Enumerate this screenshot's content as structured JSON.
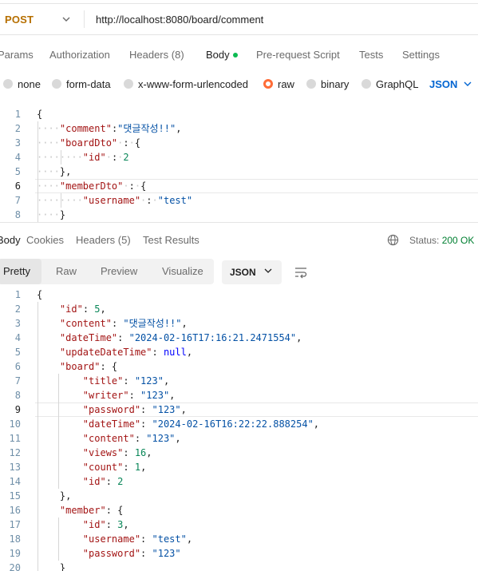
{
  "request": {
    "method": "POST",
    "url": "http://localhost:8080/board/comment"
  },
  "request_tabs": {
    "params": "Params",
    "authorization": "Authorization",
    "headers": "Headers",
    "headers_count": "(8)",
    "body": "Body",
    "pre_request_script": "Pre-request Script",
    "tests": "Tests",
    "settings": "Settings"
  },
  "body_types": {
    "none": "none",
    "form_data": "form-data",
    "urlencoded": "x-www-form-urlencoded",
    "raw": "raw",
    "binary": "binary",
    "graphql": "GraphQL",
    "selected": "raw",
    "language": "JSON"
  },
  "request_body_lines": [
    {
      "n": "1",
      "text": "{"
    },
    {
      "n": "2",
      "text": "    \"comment\":\"댓글작성!!\","
    },
    {
      "n": "3",
      "text": "    \"boardDto\" : {"
    },
    {
      "n": "4",
      "text": "        \"id\" : 2"
    },
    {
      "n": "5",
      "text": "    },"
    },
    {
      "n": "6",
      "text": "    \"memberDto\" : {"
    },
    {
      "n": "7",
      "text": "        \"username\" : \"test\""
    },
    {
      "n": "8",
      "text": "    }"
    }
  ],
  "response_tabs": {
    "body": "Body",
    "cookies": "Cookies",
    "headers": "Headers",
    "headers_count": "(5)",
    "test_results": "Test Results"
  },
  "status": {
    "label": "Status:",
    "value": "200 OK"
  },
  "view_modes": {
    "pretty": "Pretty",
    "raw": "Raw",
    "preview": "Preview",
    "visualize": "Visualize",
    "format": "JSON"
  },
  "response_body_lines": [
    {
      "n": "1",
      "text": "{"
    },
    {
      "n": "2",
      "text": "    \"id\": 5,"
    },
    {
      "n": "3",
      "text": "    \"content\": \"댓글작성!!\","
    },
    {
      "n": "4",
      "text": "    \"dateTime\": \"2024-02-16T17:16:21.2471554\","
    },
    {
      "n": "5",
      "text": "    \"updateDateTime\": null,"
    },
    {
      "n": "6",
      "text": "    \"board\": {"
    },
    {
      "n": "7",
      "text": "        \"title\": \"123\","
    },
    {
      "n": "8",
      "text": "        \"writer\": \"123\","
    },
    {
      "n": "9",
      "text": "        \"password\": \"123\","
    },
    {
      "n": "10",
      "text": "        \"dateTime\": \"2024-02-16T16:22:22.888254\","
    },
    {
      "n": "11",
      "text": "        \"content\": \"123\","
    },
    {
      "n": "12",
      "text": "        \"views\": 16,"
    },
    {
      "n": "13",
      "text": "        \"count\": 1,"
    },
    {
      "n": "14",
      "text": "        \"id\": 2"
    },
    {
      "n": "15",
      "text": "    },"
    },
    {
      "n": "16",
      "text": "    \"member\": {"
    },
    {
      "n": "17",
      "text": "        \"id\": 3,"
    },
    {
      "n": "18",
      "text": "        \"username\": \"test\","
    },
    {
      "n": "19",
      "text": "        \"password\": \"123\""
    },
    {
      "n": "20",
      "text": "    }"
    }
  ],
  "colors": {
    "method": "#b66f00",
    "accent": "#ff6c37",
    "status_ok": "#007f31",
    "body_dot": "#0cbb52",
    "json_selector": "#0265d2"
  }
}
